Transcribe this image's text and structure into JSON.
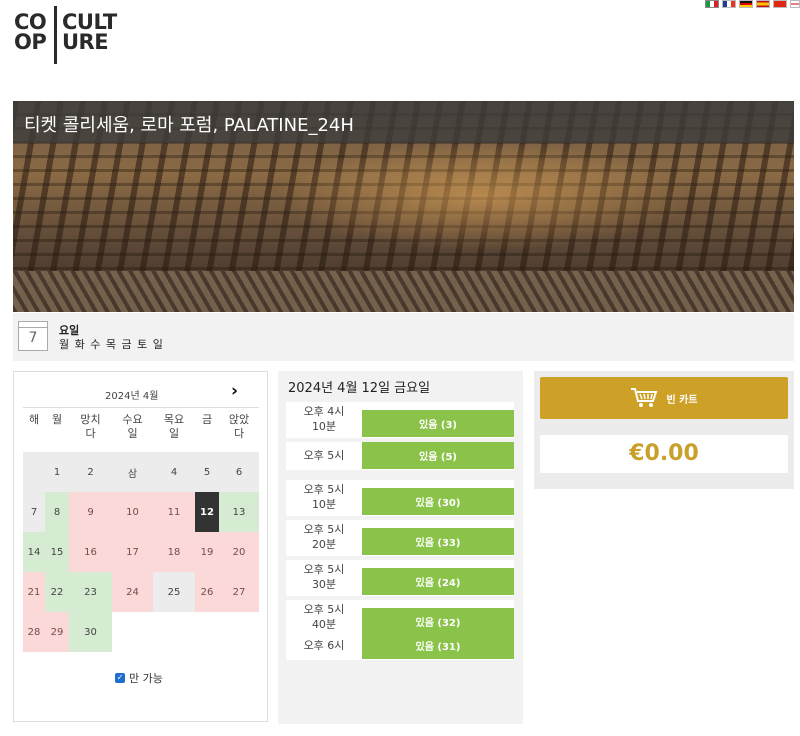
{
  "logo": {
    "letters": [
      "CO",
      "OP",
      "CULT",
      "URE"
    ]
  },
  "languages": [
    "it-flag",
    "fr-flag",
    "de-flag",
    "es-flag",
    "cn-flag",
    "gb-flag"
  ],
  "header": {
    "title": "티켓 콜리세움, 로마 포럼, PALATINE_24H"
  },
  "days_info": {
    "icon_number": "7",
    "label": "요일",
    "values": "월 화 수 목 금 토 일"
  },
  "calendar": {
    "month_label": "2024년 4월",
    "next_icon": "›",
    "weekdays": [
      "해",
      "월",
      "망치\n다",
      "수요\n일",
      "목요\n일",
      "금",
      "앉았\n다"
    ],
    "cells": [
      {
        "d": "",
        "s": "off"
      },
      {
        "d": "1",
        "s": "off"
      },
      {
        "d": "2",
        "s": "off"
      },
      {
        "d": "삼",
        "s": "off"
      },
      {
        "d": "4",
        "s": "off"
      },
      {
        "d": "5",
        "s": "off"
      },
      {
        "d": "6",
        "s": "off"
      },
      {
        "d": "7",
        "s": "off"
      },
      {
        "d": "8",
        "s": "green"
      },
      {
        "d": "9",
        "s": "red"
      },
      {
        "d": "10",
        "s": "red"
      },
      {
        "d": "11",
        "s": "red"
      },
      {
        "d": "12",
        "s": "sel"
      },
      {
        "d": "13",
        "s": "green"
      },
      {
        "d": "14",
        "s": "green"
      },
      {
        "d": "15",
        "s": "green"
      },
      {
        "d": "16",
        "s": "red"
      },
      {
        "d": "17",
        "s": "red"
      },
      {
        "d": "18",
        "s": "red"
      },
      {
        "d": "19",
        "s": "red"
      },
      {
        "d": "20",
        "s": "red"
      },
      {
        "d": "21",
        "s": "red"
      },
      {
        "d": "22",
        "s": "green"
      },
      {
        "d": "23",
        "s": "green"
      },
      {
        "d": "24",
        "s": "red"
      },
      {
        "d": "25",
        "s": "off"
      },
      {
        "d": "26",
        "s": "red"
      },
      {
        "d": "27",
        "s": "red"
      },
      {
        "d": "28",
        "s": "red"
      },
      {
        "d": "29",
        "s": "red"
      },
      {
        "d": "30",
        "s": "green"
      }
    ],
    "only_available_label": "만 가능"
  },
  "times": {
    "date_label": "2024년 4월 12일 금요일",
    "slots": [
      {
        "time": "오후 4시\n10분",
        "label": "있음 (3)"
      },
      {
        "time": "오후 5시",
        "label": "있음 (5)"
      },
      {
        "time": "오후 5시\n10분",
        "label": "있음 (30)"
      },
      {
        "time": "오후 5시\n20분",
        "label": "있음 (33)"
      },
      {
        "time": "오후 5시\n30분",
        "label": "있음 (24)"
      },
      {
        "time": "오후 5시\n40분",
        "label": "있음 (32)"
      },
      {
        "time": "오후 6시",
        "label": "있음 (31)"
      }
    ]
  },
  "cart": {
    "button_label": "빈 카트",
    "icon": "cart-icon",
    "total": "€0.00"
  },
  "colors": {
    "available": "#8bc34a",
    "cart_button": "#cda027",
    "price": "#c9a02a",
    "selected_day": "#333333"
  }
}
